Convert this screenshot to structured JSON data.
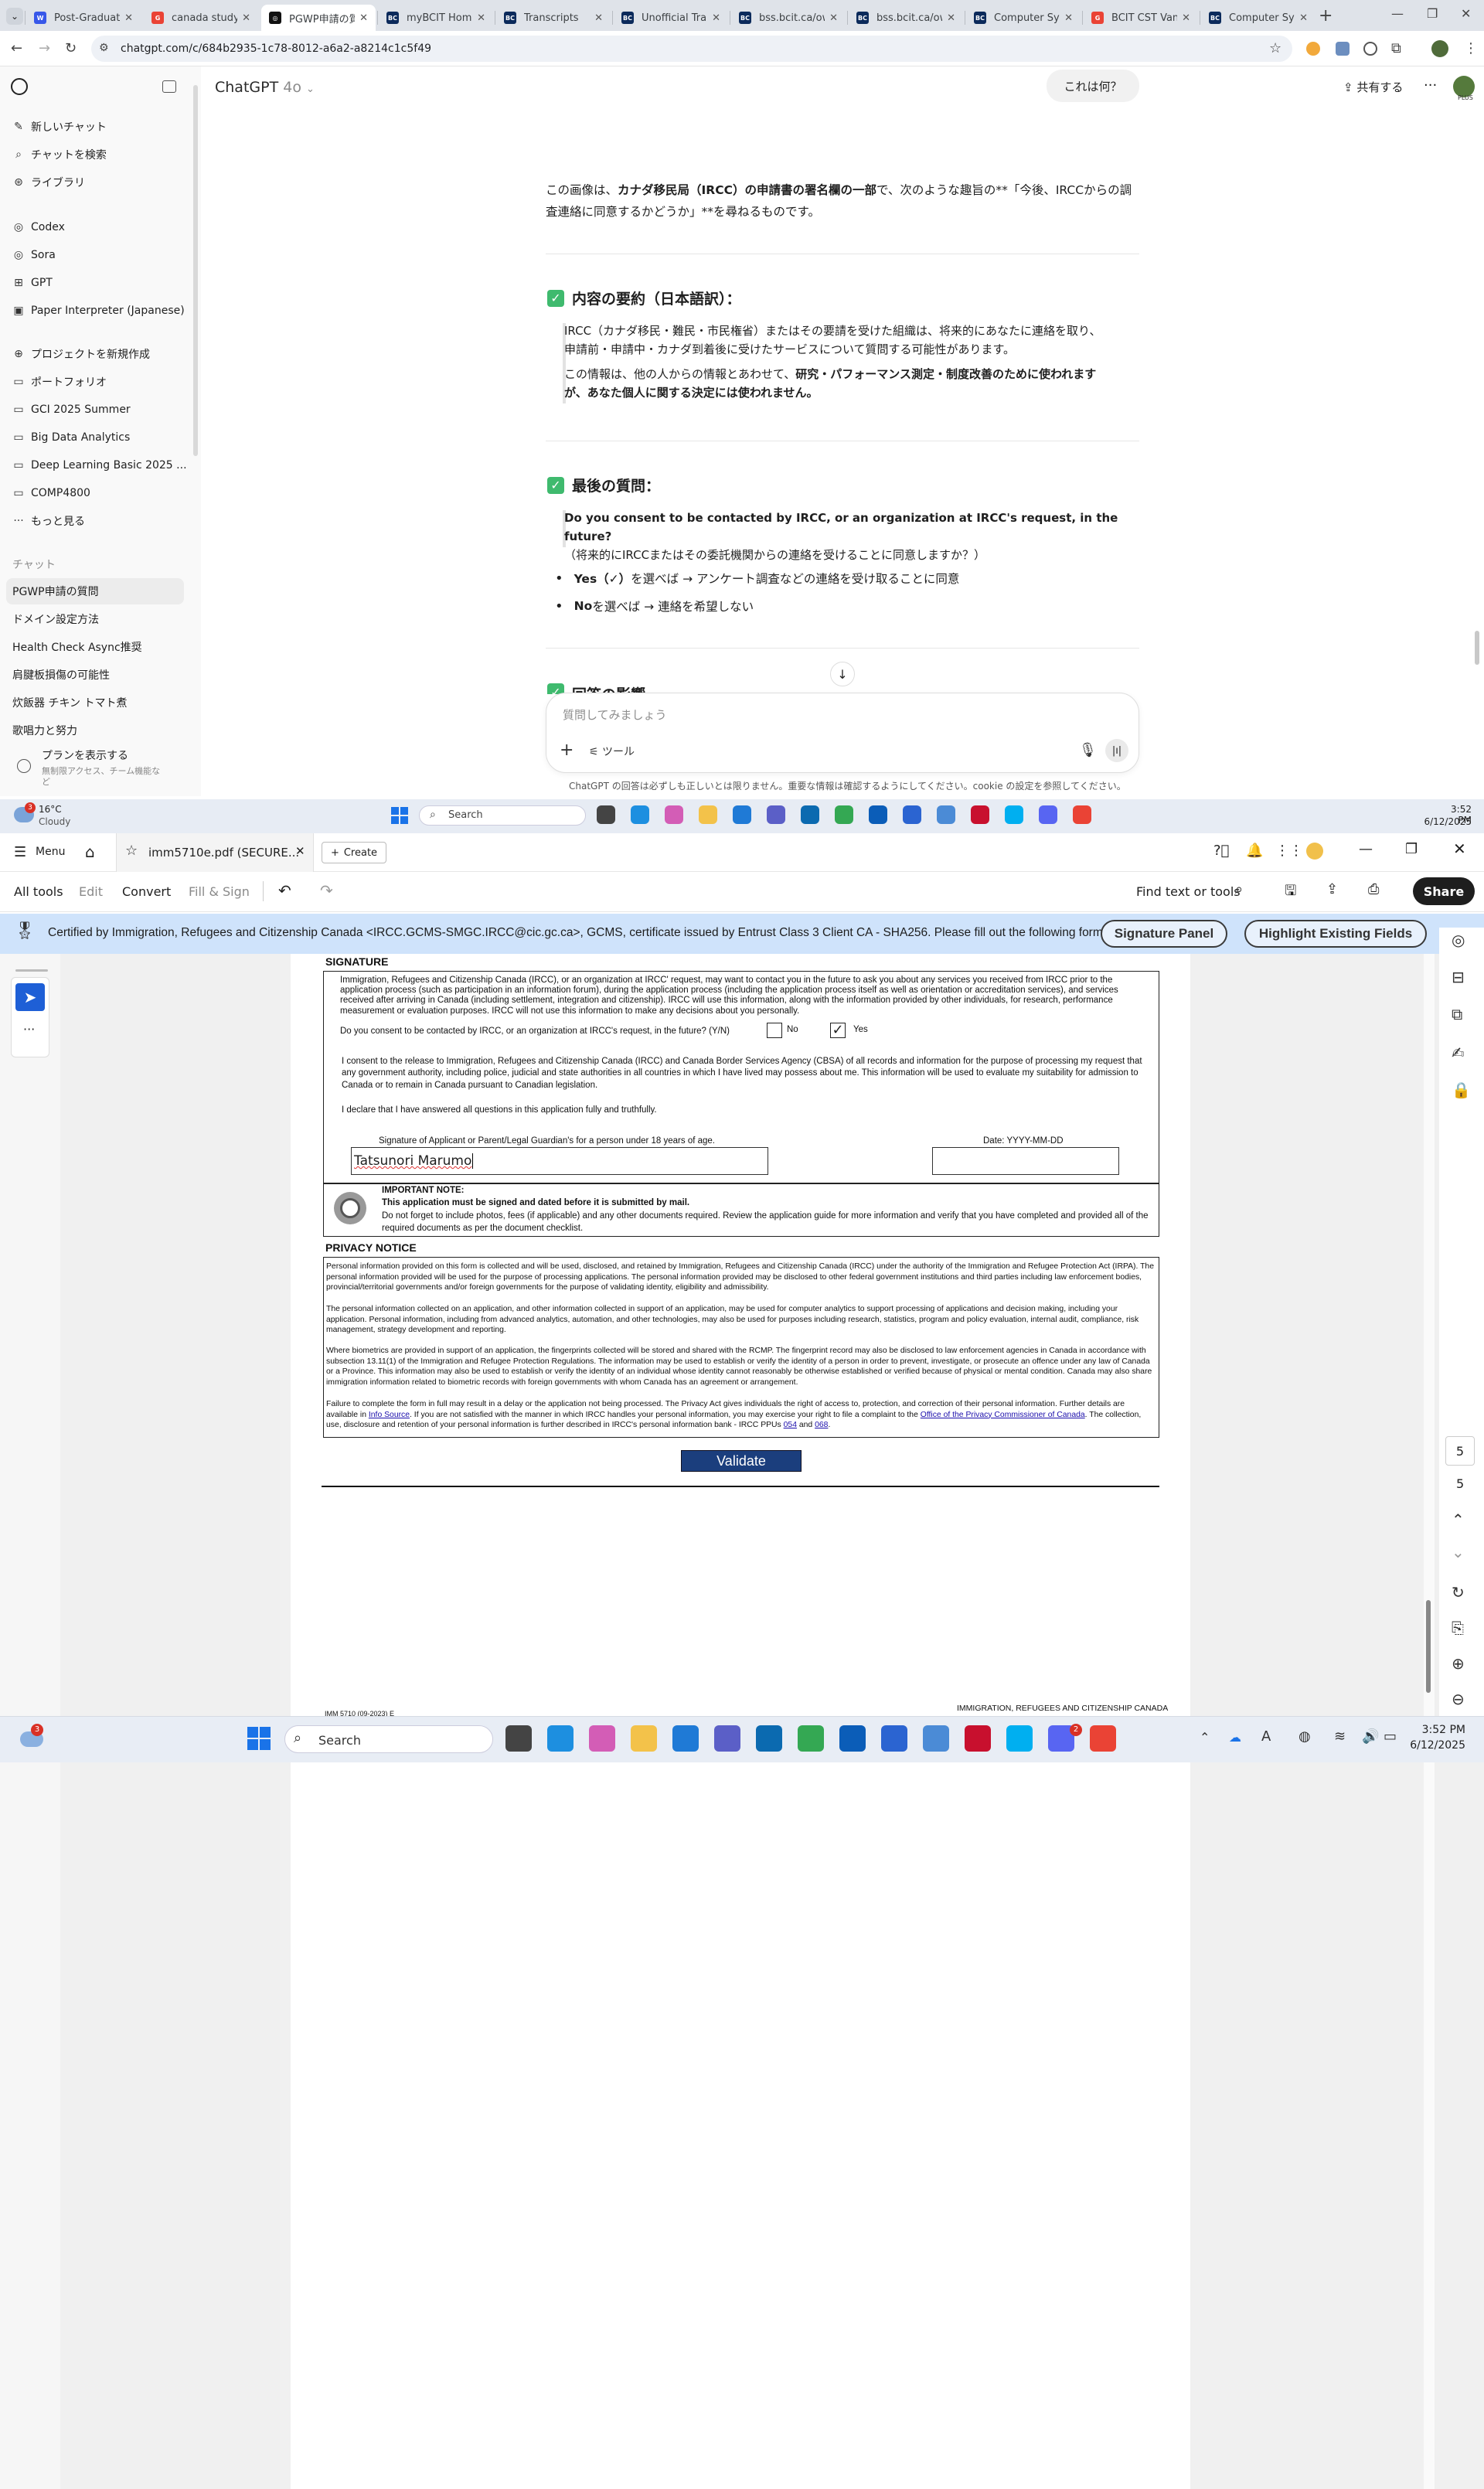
{
  "browser": {
    "tabs": [
      {
        "title": "Post-Graduatio",
        "favicon_color": "#3858e9",
        "favicon": "W"
      },
      {
        "title": "canada study p",
        "favicon_color": "#ea4335",
        "favicon": "G"
      },
      {
        "title": "PGWP申請の質",
        "favicon_color": "#111111",
        "favicon": "◎"
      },
      {
        "title": "myBCIT Home",
        "favicon_color": "#0b2a5b",
        "favicon": "BC"
      },
      {
        "title": "Transcripts",
        "favicon_color": "#0b2a5b",
        "favicon": "BC"
      },
      {
        "title": "Unofficial Trans",
        "favicon_color": "#0b2a5b",
        "favicon": "BC"
      },
      {
        "title": "bss.bcit.ca/ow",
        "favicon_color": "#0b2a5b",
        "favicon": "BC"
      },
      {
        "title": "bss.bcit.ca/ow",
        "favicon_color": "#0b2a5b",
        "favicon": "BC"
      },
      {
        "title": "Computer Syst",
        "favicon_color": "#0b2a5b",
        "favicon": "BC"
      },
      {
        "title": "BCIT CST Vanc",
        "favicon_color": "#ea4335",
        "favicon": "G"
      },
      {
        "title": "Computer Syst",
        "favicon_color": "#0b2a5b",
        "favicon": "BC"
      }
    ],
    "url": "chatgpt.com/c/684b2935-1c78-8012-a6a2-a8214c1c5f49"
  },
  "sidebar": {
    "items": [
      {
        "icon": "✎",
        "label": "新しいチャット"
      },
      {
        "icon": "⌕",
        "label": "チャットを検索"
      },
      {
        "icon": "⊛",
        "label": "ライブラリ"
      },
      {
        "icon": "◎",
        "label": "Codex"
      },
      {
        "icon": "◎",
        "label": "Sora"
      },
      {
        "icon": "⊞",
        "label": "GPT"
      },
      {
        "icon": "▣",
        "label": "Paper Interpreter (Japanese)"
      },
      {
        "icon": "⊕",
        "label": "プロジェクトを新規作成"
      },
      {
        "icon": "▭",
        "label": "ポートフォリオ"
      },
      {
        "icon": "▭",
        "label": "GCI 2025 Summer"
      },
      {
        "icon": "▭",
        "label": "Big Data Analytics"
      },
      {
        "icon": "▭",
        "label": "Deep Learning Basic 2025 ..."
      },
      {
        "icon": "▭",
        "label": "COMP4800"
      },
      {
        "icon": "···",
        "label": "もっと見る"
      }
    ],
    "section_chats": "チャット",
    "chats": [
      "PGWP申請の質問",
      "ドメイン設定方法",
      "Health Check Async推奨",
      "肩腱板損傷の可能性",
      "炊飯器 チキン トマト煮",
      "歌唱力と努力"
    ],
    "plan_title": "プランを表示する",
    "plan_sub": "無制限アクセス、チーム機能な",
    "plan_sub2": "ど"
  },
  "chat": {
    "title": "ChatGPT",
    "model": "4o",
    "user_bubble": "これは何？",
    "share_label": "共有する",
    "avatar_badge": "PLUS",
    "intro_1": "この画像は、",
    "intro_bold": "カナダ移民局（IRCC）の申請書の署名欄の一部",
    "intro_2": "で、次のような趣旨の**「今後、IRCCからの調",
    "intro_3": "査連絡に同意するかどうか」**を尋ねるものです。",
    "section1_title": "内容の要約（日本語訳）：",
    "s1_line1": "IRCC（カナダ移民・難民・市民権省）またはその要請を受けた組織は、将来的にあなたに連絡を取り、",
    "s1_line2": "申請前・申請中・カナダ到着後に受けたサービスについて質問する可能性があります。",
    "s1_line3a": "この情報は、他の人からの情報とあわせて、",
    "s1_line3b": "研究・パフォーマンス測定・制度改善のために使われます",
    "s1_line4": "が、あなた個人に関する決定には使われません。",
    "section2_title": "最後の質問：",
    "q_en": "Do you consent to be contacted by IRCC, or an organization at IRCC's request, in the future?",
    "q_jp": "（将来的にIRCCまたはその委託機関からの連絡を受けることに同意しますか？）",
    "bullet1_b": "Yes（✓）",
    "bullet1": " を選べば → アンケート調査などの連絡を受け取ることに同意",
    "bullet2_b": "No",
    "bullet2": " を選べば → 連絡を希望しない",
    "section3_title_partial": "回答の影響",
    "input_placeholder": "質問してみましょう",
    "tools_label": "ツール",
    "disclaimer": "ChatGPT の回答は必ずしも正しいとは限りません。重要な情報は確認するようにしてください。cookie の設定を参照してください。"
  },
  "taskbar_small": {
    "temp": "16°C",
    "weather": "Cloudy",
    "search": "Search",
    "time": "3:52 PM",
    "date": "6/12/2025",
    "badge_weather": "3"
  },
  "acrobat": {
    "menu": "Menu",
    "tab_title": "imm5710e.pdf (SECURE...",
    "create": "Create",
    "toolbar": [
      "All tools",
      "Edit",
      "Convert",
      "Fill & Sign"
    ],
    "find": "Find text or tools",
    "share": "Share",
    "cert_text": "Certified by Immigration, Refugees and Citizenship Canada <IRCC.GCMS-SMGC.IRCC@cic.gc.ca>, GCMS, certificate issued by Entrust Class 3 Client CA - SHA256.  Please fill out the following form.",
    "signature_panel": "Signature Panel",
    "highlight_fields": "Highlight Existing Fields",
    "page_num": "5",
    "page_total": "5"
  },
  "pdf": {
    "signature_heading": "SIGNATURE",
    "para1": "Immigration, Refugees and Citizenship Canada (IRCC), or an organization at IRCC' request, may want to contact you in the future to ask you about any services you received from IRCC prior to the application process (such as participation in an information forum), during the application process (including the application process itself as well as orientation or accreditation services), and services received after arriving in Canada (including settlement, integration and citizenship).  IRCC will use this information, along with the information provided by other individuals, for research, performance measurement or evaluation purposes.  IRCC will not use this information to make any decisions about you personally.",
    "consent_q": "Do you consent to be contacted by IRCC, or an organization at IRCC's request, in the future? (Y/N)",
    "no": "No",
    "yes": "Yes",
    "yes_mark": "✓",
    "para2": "I consent to the release to Immigration, Refugees and Citizenship Canada (IRCC) and Canada Border Services Agency (CBSA) of all records and information for the purpose of processing my request that any government authority, including police, judicial and state authorities in all countries in which I have lived may possess about me. This information will be used to evaluate my suitability for admission to Canada or to remain in Canada pursuant to Canadian legislation.",
    "para3": "I declare that I have answered all questions in this application fully and truthfully.",
    "sig_label": "Signature of Applicant or Parent/Legal Guardian's for a person under 18 years of age.",
    "date_label": "Date: YYYY-MM-DD",
    "sig_value": "Tatsunori Marumo",
    "date_value": "",
    "note_title": "IMPORTANT NOTE:",
    "note_bold": "This application must be signed and dated before it is submitted by mail.",
    "note_text": "Do not forget to include photos, fees (if applicable) and any other documents required. Review the application guide for more information and verify that you have completed and provided all of the required documents as per the document checklist.",
    "privacy_heading": "PRIVACY NOTICE",
    "priv1": "Personal information provided on this form is collected and will be used, disclosed, and retained by Immigration, Refugees and Citizenship Canada (IRCC) under the authority of the Immigration and Refugee Protection Act (IRPA). The personal information provided will be used for the purpose of processing applications. The personal information provided may be disclosed to other federal government institutions and third parties including law enforcement bodies, provincial/territorial governments and/or foreign governments for the purpose of validating identity, eligibility and admissibility.",
    "priv2": "The personal information collected on an application, and other information collected in support of an application, may be used for computer analytics to support processing of applications and decision making, including your application. Personal information, including from advanced analytics, automation, and other technologies, may also be used for purposes including research, statistics, program and policy evaluation, internal audit, compliance, risk management, strategy development and reporting.",
    "priv3": "Where biometrics are provided in support of an application, the fingerprints collected will be stored and shared with the RCMP.  The fingerprint record may also be disclosed to law enforcement agencies in Canada in accordance with subsection 13.11(1) of the Immigration and Refugee Protection Regulations.  The information may be used to establish or verify the identity of a person in order to prevent, investigate, or prosecute an offence under any law of Canada or a Province.  This information may also be used to establish or verify the identity of an individual whose identity cannot reasonably be otherwise established or verified because of physical or mental condition.  Canada may also share immigration information related to biometric records with foreign governments with whom Canada has an agreement or arrangement.",
    "priv4a": "Failure to complete the form in full may result in a delay or the application not being processed. The Privacy Act gives individuals the right of access to, protection, and correction of their personal information. Further details are available in ",
    "priv4_link1": "Info Source",
    "priv4b": ". If you are not satisfied with the manner in which IRCC handles your personal information, you may exercise your right to file a complaint to the ",
    "priv4_link2": "Office of the Privacy Commissioner of Canada",
    "priv4c": ". The collection, use, disclosure and retention of your personal information is further described in IRCC's personal information bank - IRCC PPUs ",
    "priv4_link3": "054",
    "priv4d": " and ",
    "priv4_link4": "068",
    "priv4e": ".",
    "validate": "Validate",
    "footer_left": "IMM 5710 (09-2023) E",
    "footer_right": "IMMIGRATION, REFUGEES AND CITIZENSHIP CANADA"
  },
  "taskbar_big": {
    "search": "Search",
    "time": "3:52 PM",
    "date": "6/12/2025",
    "badge_weather": "3",
    "badge_discord": "2"
  }
}
